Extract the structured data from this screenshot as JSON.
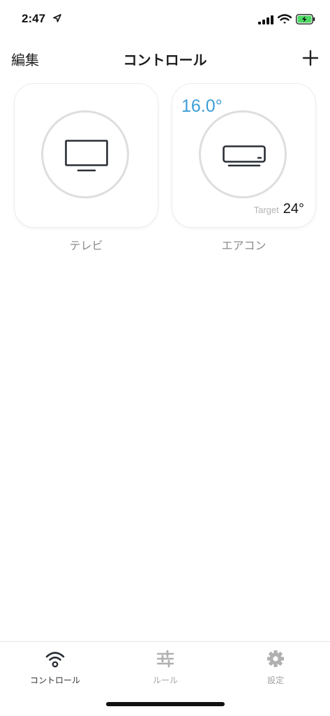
{
  "status_bar": {
    "time": "2:47",
    "icons": [
      "location-arrow-icon",
      "cellular-signal-icon",
      "wifi-icon",
      "battery-charging-icon"
    ]
  },
  "nav": {
    "edit_label": "編集",
    "title": "コントロール",
    "add_icon": "plus-icon"
  },
  "devices": [
    {
      "label": "テレビ",
      "icon": "tv-icon"
    },
    {
      "label": "エアコン",
      "icon": "air-conditioner-icon",
      "current_temp": "16.0°",
      "target_label": "Target",
      "target_temp": "24°"
    }
  ],
  "colors": {
    "accent_blue": "#3c9ed8",
    "ring": "#dedede",
    "label_gray": "#8a8a8a",
    "inactive_gray": "#a3a3a3"
  },
  "tab_bar": {
    "tabs": [
      {
        "label": "コントロール",
        "icon": "wifi-icon",
        "active": true
      },
      {
        "label": "ルール",
        "icon": "sliders-icon",
        "active": false
      },
      {
        "label": "設定",
        "icon": "gear-icon",
        "active": false
      }
    ]
  }
}
